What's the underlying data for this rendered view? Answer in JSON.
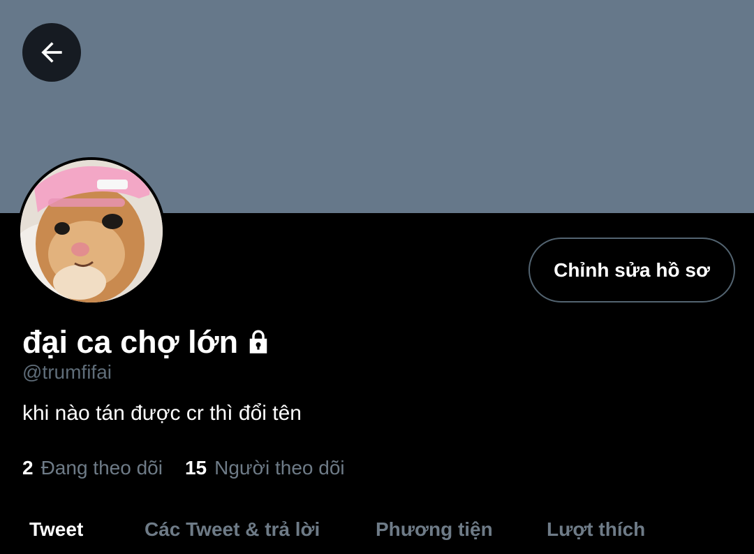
{
  "profile": {
    "name": "đại ca chợ lớn",
    "handle": "@trumfifai",
    "bio": "khi nào tán được cr thì đổi tên",
    "edit_label": "Chỉnh sửa hồ sơ",
    "following_count": "2",
    "following_label": "Đang theo dõi",
    "followers_count": "15",
    "followers_label": "Người theo dõi"
  },
  "tabs": [
    {
      "label": "Tweet",
      "active": true
    },
    {
      "label": "Các Tweet & trả lời",
      "active": false
    },
    {
      "label": "Phương tiện",
      "active": false
    },
    {
      "label": "Lượt thích",
      "active": false
    }
  ],
  "colors": {
    "banner": "#66788a",
    "background": "#000000",
    "muted_text": "#6e7b87",
    "button_border": "#536471"
  },
  "icons": [
    "back-arrow-icon",
    "lock-icon"
  ]
}
